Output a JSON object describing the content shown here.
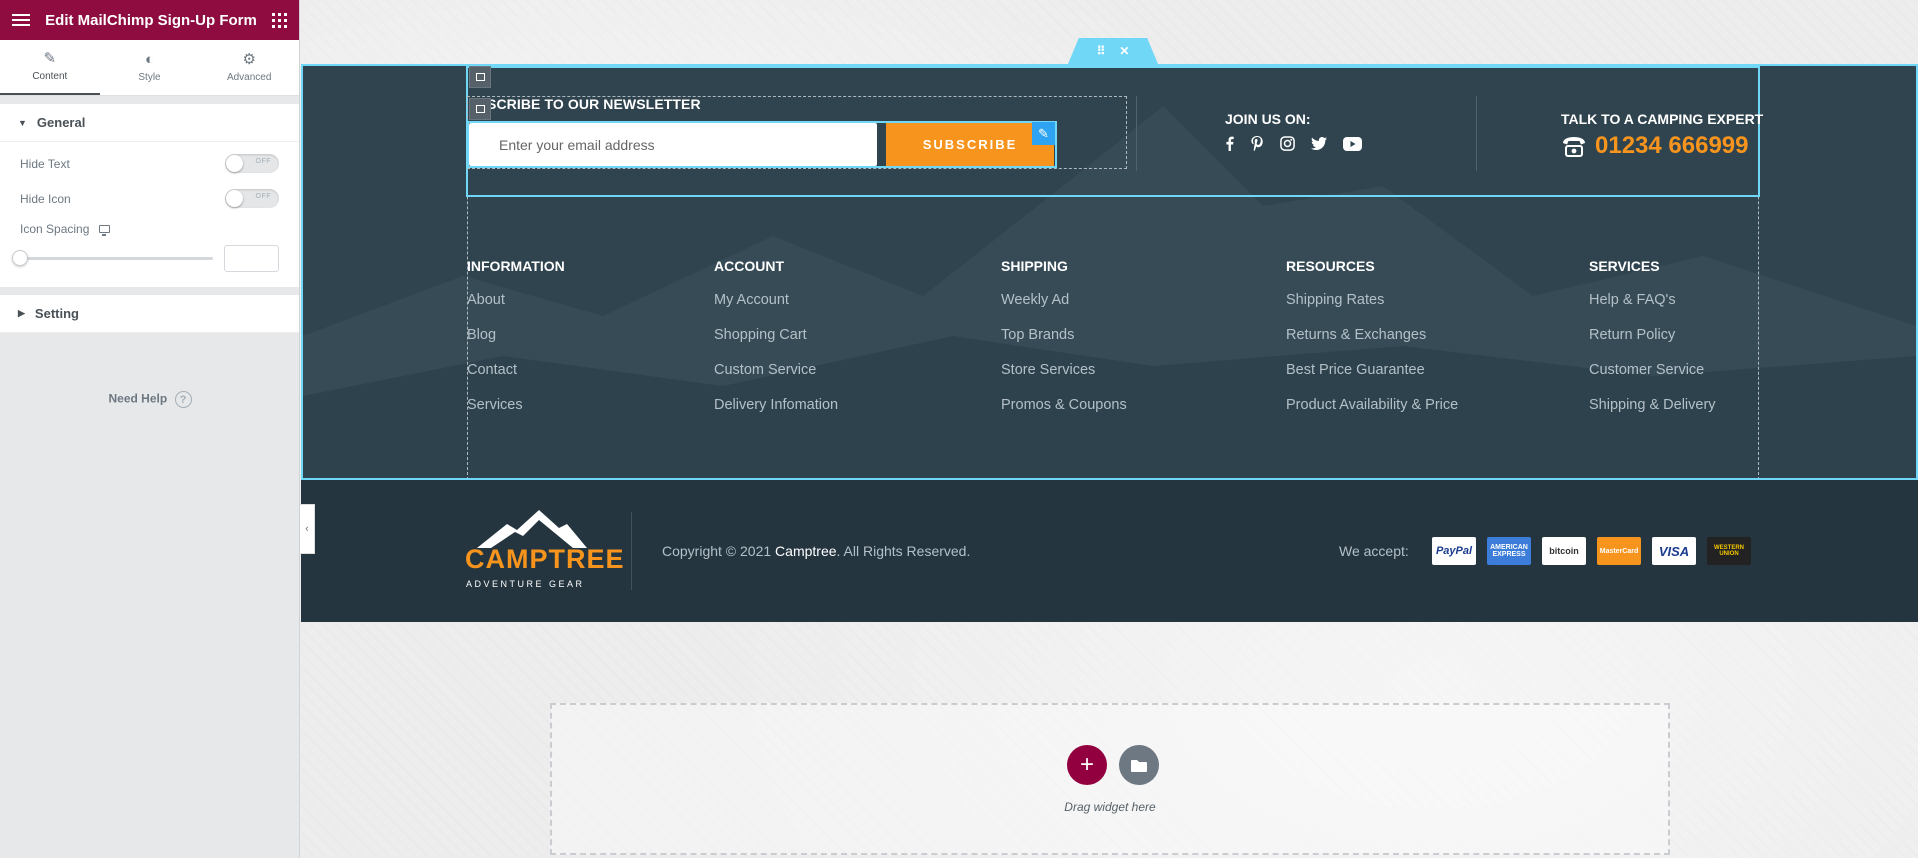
{
  "panel": {
    "title": "Edit MailChimp Sign-Up Form",
    "tabs": [
      {
        "label": "Content",
        "icon": "pencil-icon"
      },
      {
        "label": "Style",
        "icon": "half-circle-icon"
      },
      {
        "label": "Advanced",
        "icon": "gear-icon"
      }
    ],
    "general": {
      "heading": "General",
      "hide_text": {
        "label": "Hide Text",
        "state": "OFF"
      },
      "hide_icon": {
        "label": "Hide Icon",
        "state": "OFF"
      },
      "icon_spacing": {
        "label": "Icon Spacing",
        "value": ""
      }
    },
    "setting_heading": "Setting",
    "need_help": "Need Help"
  },
  "footer": {
    "newsletter": {
      "title": "SCRIBE TO OUR NEWSLETTER",
      "email_placeholder": "Enter your email address",
      "button_label": "SUBSCRIBE"
    },
    "join": {
      "title": "JOIN US ON:",
      "icons": [
        "facebook-icon",
        "pinterest-icon",
        "instagram-icon",
        "twitter-icon",
        "youtube-icon"
      ]
    },
    "talk": {
      "title": "TALK TO A CAMPING EXPERT",
      "phone": "01234 666999"
    },
    "columns": [
      {
        "heading": "INFORMATION",
        "links": [
          "About",
          "Blog",
          "Contact",
          "Services"
        ]
      },
      {
        "heading": "ACCOUNT",
        "links": [
          "My Account",
          "Shopping Cart",
          "Custom Service",
          "Delivery Infomation"
        ]
      },
      {
        "heading": "SHIPPING",
        "links": [
          "Weekly Ad",
          "Top Brands",
          "Store Services",
          "Promos & Coupons"
        ]
      },
      {
        "heading": "RESOURCES",
        "links": [
          "Shipping Rates",
          "Returns & Exchanges",
          "Best Price Guarantee",
          "Product Availability & Price"
        ]
      },
      {
        "heading": "SERVICES",
        "links": [
          "Help & FAQ's",
          "Return Policy",
          "Customer Service",
          "Shipping & Delivery"
        ]
      }
    ],
    "bottom": {
      "logo_brand": "CAMPTREE",
      "logo_tagline": "ADVENTURE GEAR",
      "copyright_prefix": "Copyright © 2021",
      "copyright_brand": "Camptree",
      "copyright_suffix": ". All Rights Reserved.",
      "we_accept": "We accept:",
      "payments": {
        "paypal": "PayPal",
        "amex": "AMERICAN EXPRESS",
        "bitcoin": "bitcoin",
        "mastercard": "MasterCard",
        "visa": "VISA",
        "western_union": "WESTERN UNION"
      }
    }
  },
  "dropzone": {
    "text": "Drag widget here",
    "add_label": "+"
  },
  "colors": {
    "brand": "#93003f",
    "accent": "#f7941d",
    "footer_bg": "#30444f",
    "selection": "#71d7f7"
  }
}
